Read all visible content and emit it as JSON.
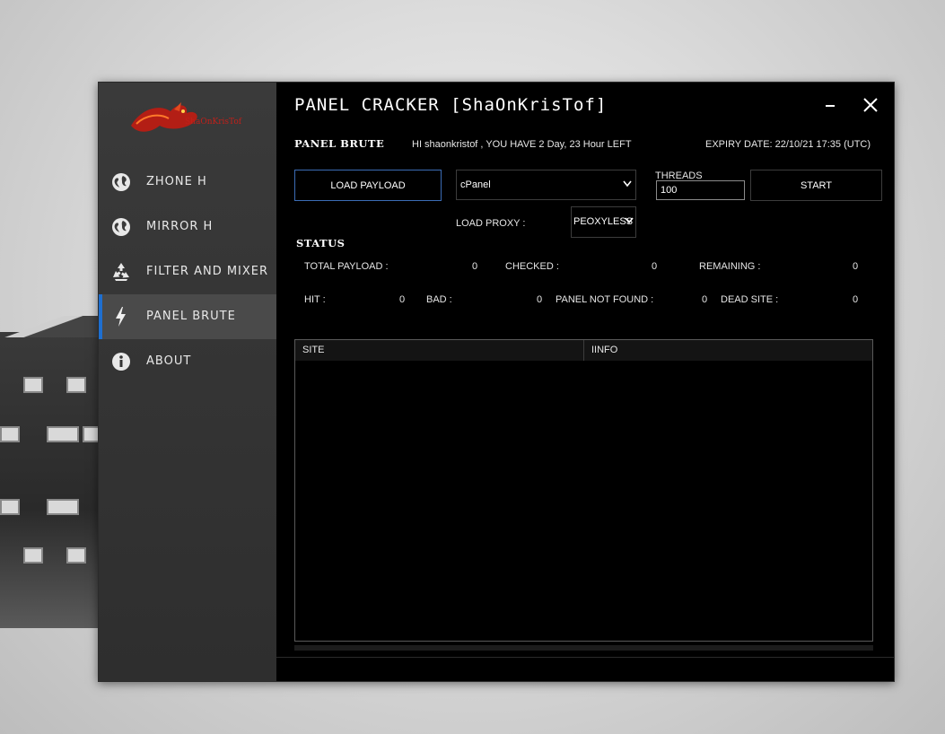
{
  "app": {
    "title": "PANEL CRACKER [ShaOnKrisTof]",
    "logo_text": "ShaOnKrisTof",
    "accent_color": "#1e6fd0",
    "logo_color": "#c0201a"
  },
  "sidebar": {
    "items": [
      {
        "label": "ZHONE H",
        "icon": "globe-icon"
      },
      {
        "label": "MIRROR H",
        "icon": "globe-icon"
      },
      {
        "label": "FILTER AND MIXER",
        "icon": "recycle-icon"
      },
      {
        "label": "PANEL BRUTE",
        "icon": "lightning-icon",
        "active": true
      },
      {
        "label": "ABOUT",
        "icon": "info-icon"
      }
    ]
  },
  "header": {
    "section": "PANEL BRUTE",
    "greeting": "HI shaonkristof , YOU HAVE 2 Day, 23 Hour LEFT",
    "expiry": "EXPIRY DATE: 22/10/21 17:35 (UTC)"
  },
  "controls": {
    "load_payload_label": "LOAD PAYLOAD",
    "panel_type": "cPanel",
    "threads_label": "THREADS",
    "threads_value": "100",
    "start_label": "START",
    "load_proxy_label": "LOAD PROXY :",
    "proxy_value": "PEOXYLESS"
  },
  "status": {
    "title": "STATUS",
    "total_payload_label": "TOTAL PAYLOAD :",
    "total_payload": "0",
    "checked_label": "CHECKED :",
    "checked": "0",
    "remaining_label": "REMAINING :",
    "remaining": "0",
    "hit_label": "HIT :",
    "hit": "0",
    "bad_label": "BAD :",
    "bad": "0",
    "panel_not_found_label": "PANEL NOT FOUND :",
    "panel_not_found": "0",
    "dead_site_label": "DEAD SITE :",
    "dead_site": "0"
  },
  "grid": {
    "columns": [
      "SITE",
      "IINFO"
    ]
  }
}
